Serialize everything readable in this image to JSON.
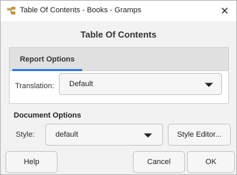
{
  "window": {
    "title": "Table Of Contents - Books - Gramps",
    "close_glyph": "✕"
  },
  "header": {
    "title": "Table Of Contents"
  },
  "tabs": [
    {
      "label": "Report Options",
      "selected": true
    }
  ],
  "report_options": {
    "translation_label": "Translation:",
    "translation_value": "Default"
  },
  "document_options": {
    "section_title": "Document Options",
    "style_label": "Style:",
    "style_value": "default",
    "style_editor_label": "Style Editor..."
  },
  "buttons": {
    "help": "Help",
    "cancel": "Cancel",
    "ok": "OK"
  },
  "colors": {
    "accent": "#2f78e8",
    "tabbar": "#e0e0e0",
    "dialog_bg": "#f2f2f2"
  },
  "icons": {
    "app": "gramps-app-icon",
    "close": "close-icon",
    "dropdown": "chevron-down-icon"
  }
}
